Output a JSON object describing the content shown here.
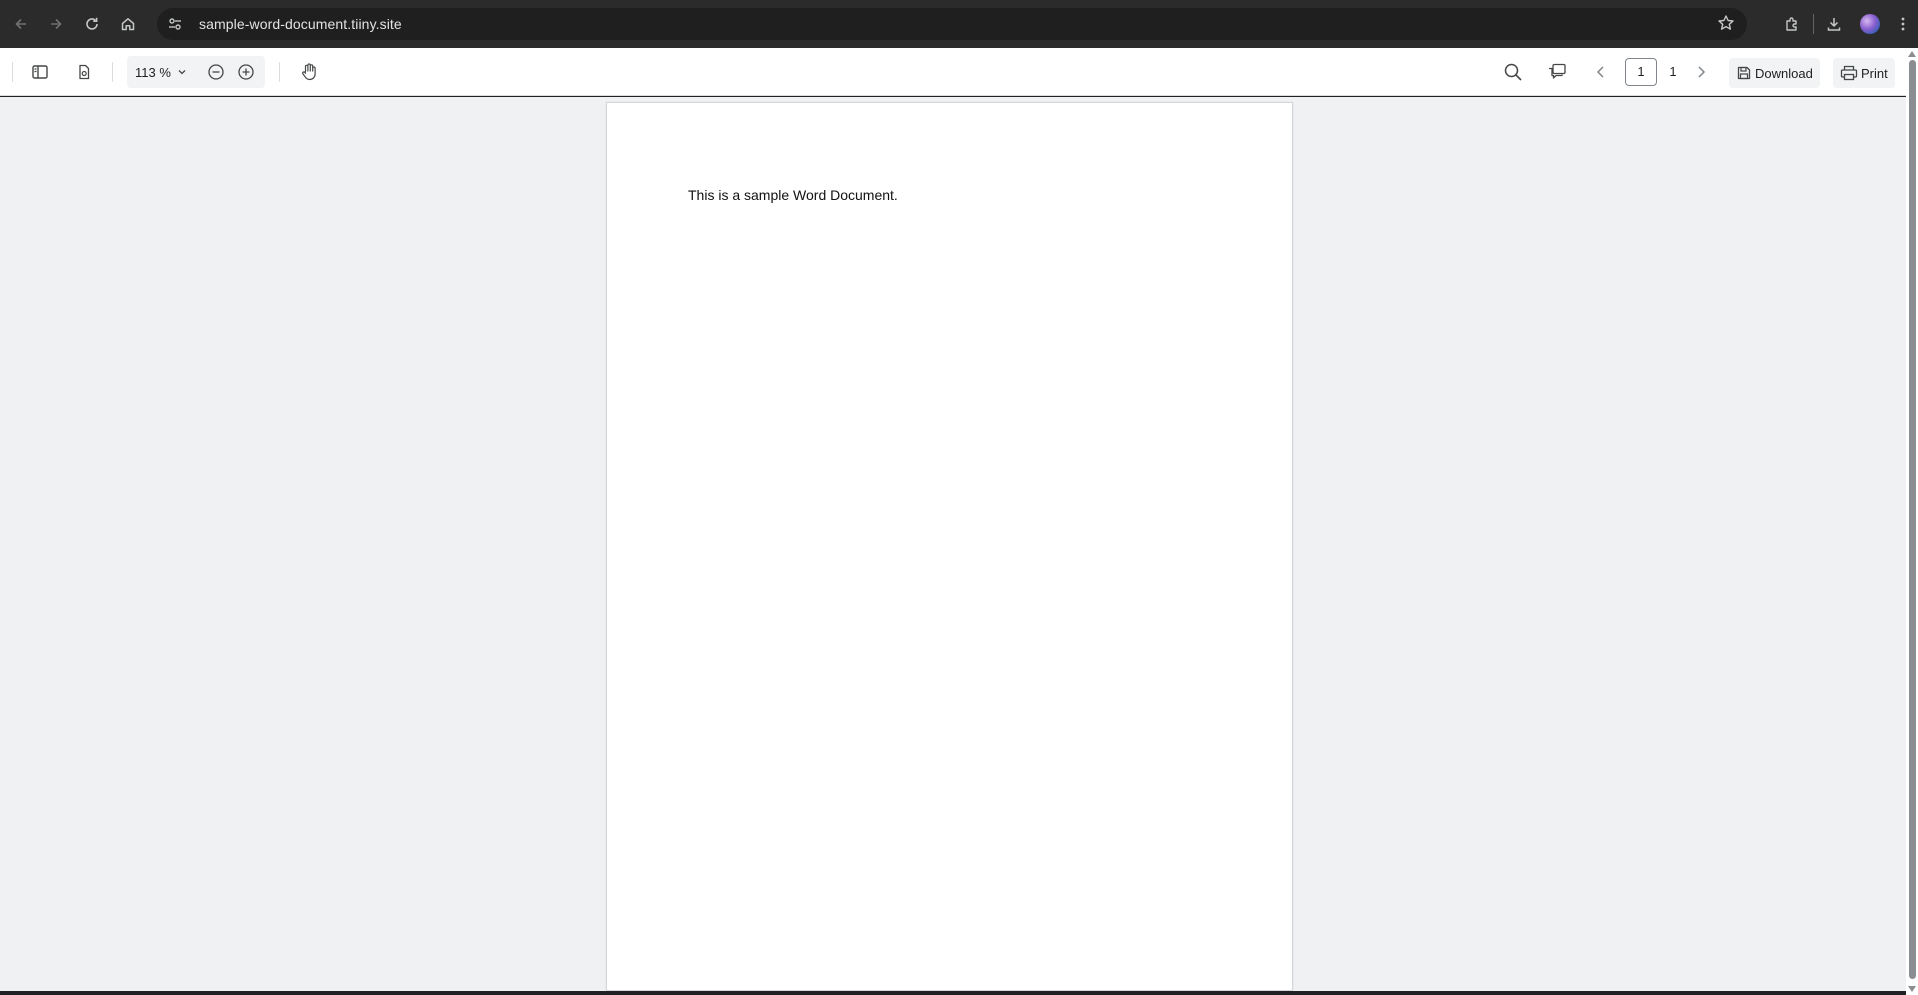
{
  "browser": {
    "url": "sample-word-document.tiiny.site",
    "icons": [
      "back-arrow-icon",
      "forward-arrow-icon",
      "reload-icon",
      "home-icon",
      "site-info-icon",
      "bookmark-star-icon",
      "extensions-icon",
      "downloads-icon",
      "profile-avatar",
      "kebab-menu-icon"
    ]
  },
  "pdf_toolbar": {
    "zoom_value": "113 %",
    "current_page": "1",
    "total_pages": "1",
    "download_label": "Download",
    "print_label": "Print"
  },
  "document": {
    "text": "This is a sample Word Document."
  },
  "colors": {
    "chrome_bg": "#2b2b2c",
    "omnibox_bg": "#1f1f20",
    "toolbar_bg": "#ffffff",
    "viewer_bg": "#f0f1f3",
    "page_bg": "#ffffff"
  }
}
